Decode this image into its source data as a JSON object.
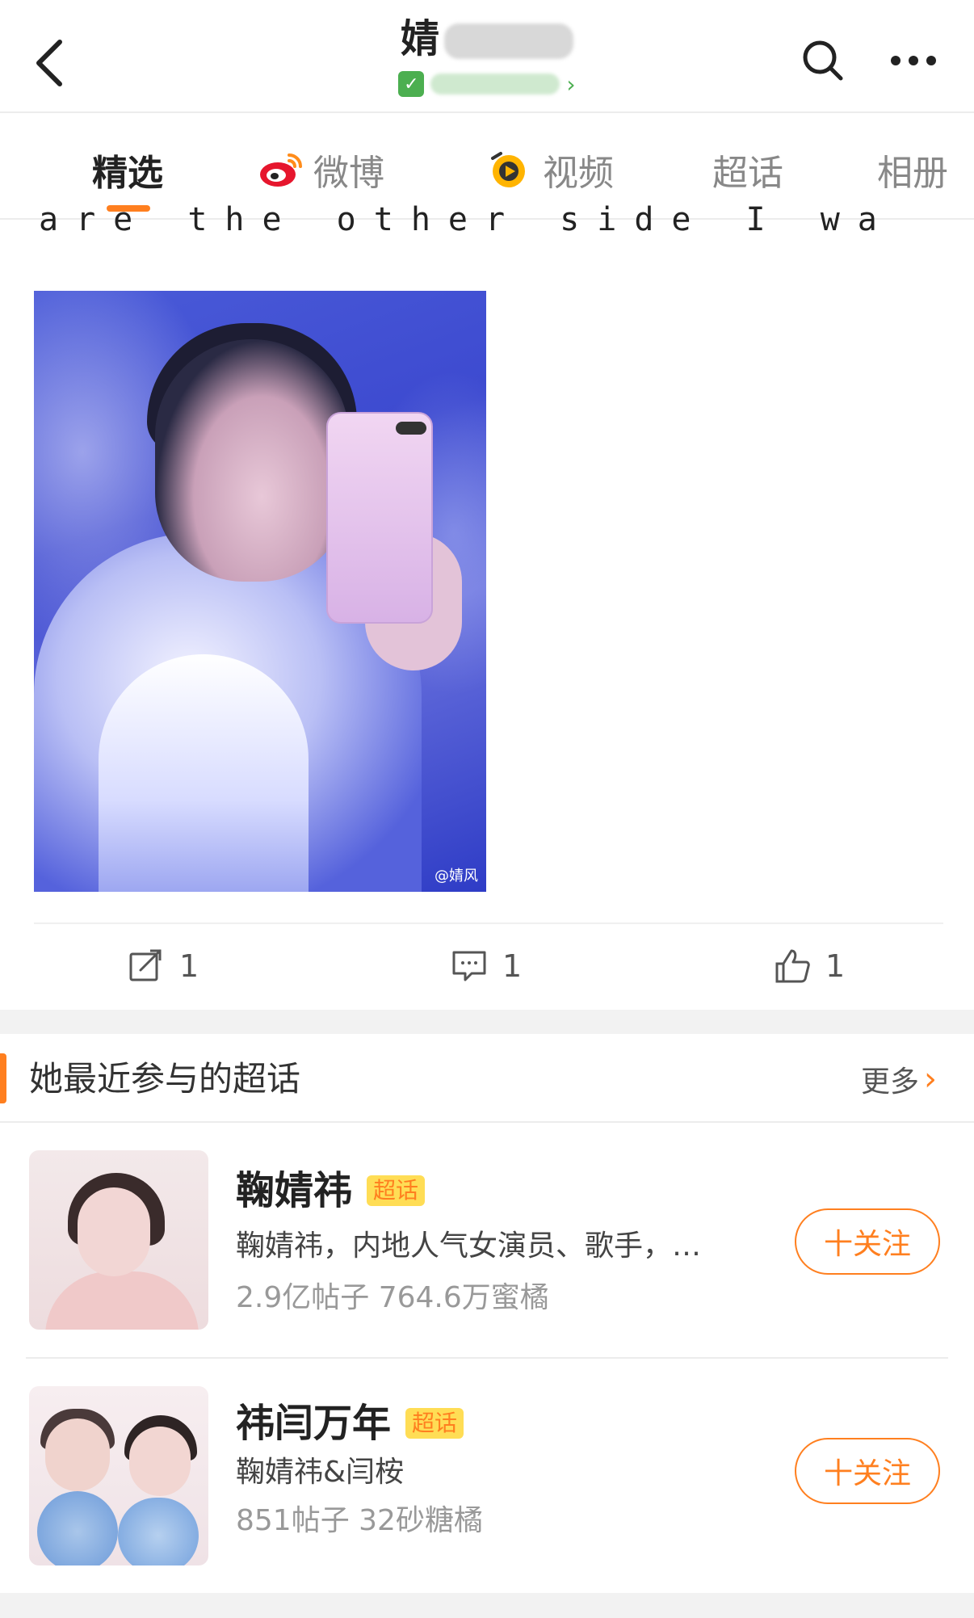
{
  "header": {
    "title_visible": "婧",
    "back_icon": "chevron-left-icon",
    "search_icon": "search-icon",
    "more_icon": "more-dots-icon"
  },
  "tabs": [
    {
      "label": "精选",
      "active": true
    },
    {
      "label": "微博",
      "icon": "weibo-logo-icon"
    },
    {
      "label": "视频",
      "icon": "video-icon"
    },
    {
      "label": "超话"
    },
    {
      "label": "相册"
    }
  ],
  "post": {
    "text": "are the other side I want to reach.",
    "watermark": "@婧风",
    "actions": {
      "repost_count": "1",
      "comment_count": "1",
      "like_count": "1"
    }
  },
  "super_topics": {
    "title": "她最近参与的超话",
    "more_label": "更多",
    "items": [
      {
        "name": "鞠婧祎",
        "badge": "超话",
        "desc": "鞠婧祎，内地人气女演员、歌手，…",
        "stats": "2.9亿帖子 764.6万蜜橘",
        "follow_label": "十关注"
      },
      {
        "name": "祎闫万年",
        "badge": "超话",
        "desc": "鞠婧祎&闫桉",
        "stats": "851帖子 32砂糖橘",
        "follow_label": "十关注"
      }
    ]
  },
  "colors": {
    "accent": "#ff7f1f",
    "badge_bg": "#ffdd55",
    "verified_green": "#4caf50"
  }
}
